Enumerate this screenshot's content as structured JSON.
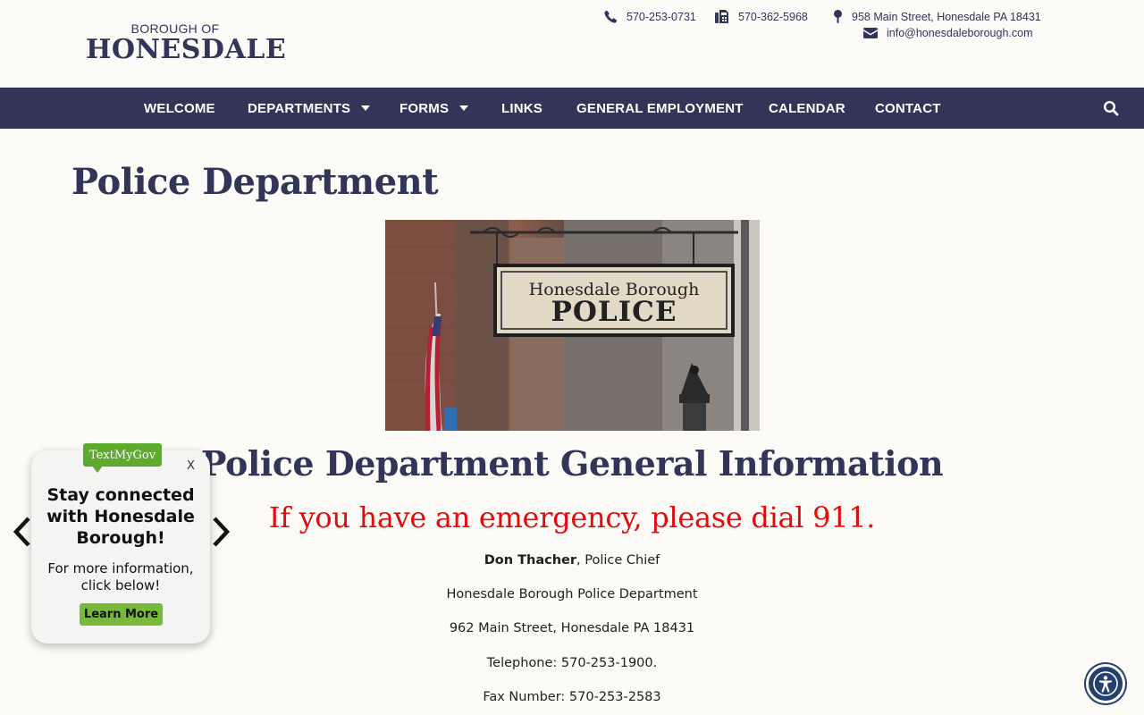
{
  "logo": {
    "top": "BOROUGH OF",
    "main": "HONESDALE"
  },
  "contact": {
    "phone": "570-253-0731",
    "fax": "570-362-5968",
    "address": "958 Main Street, Honesdale PA 18431",
    "email": "info@honesdaleborough.com"
  },
  "nav": {
    "items": [
      {
        "label": "WELCOME"
      },
      {
        "label": "DEPARTMENTS"
      },
      {
        "label": "FORMS"
      },
      {
        "label": "LINKS"
      },
      {
        "label": "GENERAL EMPLOYMENT"
      },
      {
        "label": "CALENDAR"
      },
      {
        "label": "CONTACT"
      }
    ]
  },
  "page": {
    "title": "Police Department",
    "sign_line1": "Honesdale Borough",
    "sign_line2": "POLICE",
    "section_title": "Police Department General Information",
    "emergency": "If you have an emergency, please dial 911.",
    "chief_name": "Don Thacher",
    "chief_role": ", Police Chief",
    "dept_name": "Honesdale Borough Police Department",
    "dept_address": "962 Main Street, Honesdale PA 18431",
    "telephone": "Telephone: 570-253-1900.",
    "fax": "Fax Number: 570-253-2583"
  },
  "widget": {
    "badge": "TextMyGov",
    "close": "X",
    "headline": "Stay connected with Honesdale Borough!",
    "sub": "For more information, click below!",
    "button": "Learn More"
  },
  "icons": {
    "phone": "phone-icon",
    "fax": "fax-icon",
    "address": "map-pin-icon",
    "email": "envelope-icon",
    "search": "search-icon",
    "accessibility": "accessibility-icon"
  },
  "colors": {
    "brand_navy": "#323558",
    "emergency_red": "#e00d0d",
    "widget_green": "#5eaa2d"
  }
}
